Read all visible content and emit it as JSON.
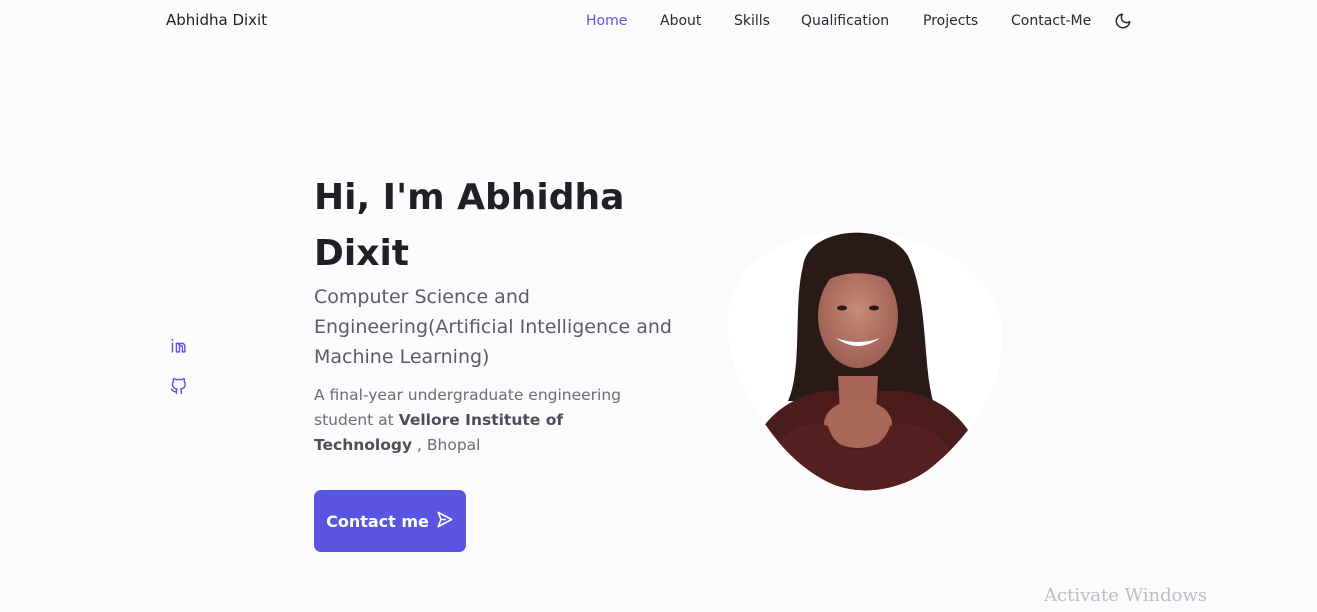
{
  "header": {
    "logo": "Abhidha Dixit",
    "nav": [
      {
        "label": "Home",
        "active": true
      },
      {
        "label": "About",
        "active": false
      },
      {
        "label": "Skills",
        "active": false
      },
      {
        "label": "Qualification",
        "active": false
      },
      {
        "label": "Projects",
        "active": false
      },
      {
        "label": "Contact-Me",
        "active": false
      }
    ],
    "theme_icon": "moon-icon"
  },
  "social": [
    {
      "icon": "linkedin-icon"
    },
    {
      "icon": "github-icon"
    }
  ],
  "hero": {
    "title": "Hi, I'm Abhidha Dixit",
    "subtitle": "Computer Science and Engineering(Artificial Intelligence and Machine Learning)",
    "desc_prefix": "A final-year undergraduate engineering student at ",
    "desc_bold": "Vellore Institute of Technology",
    "desc_suffix": " , Bhopal",
    "cta_label": "Contact me",
    "cta_icon": "send-icon",
    "accent_color": "#5a55e0"
  },
  "overlay": {
    "watermark": "Activate Windows"
  }
}
